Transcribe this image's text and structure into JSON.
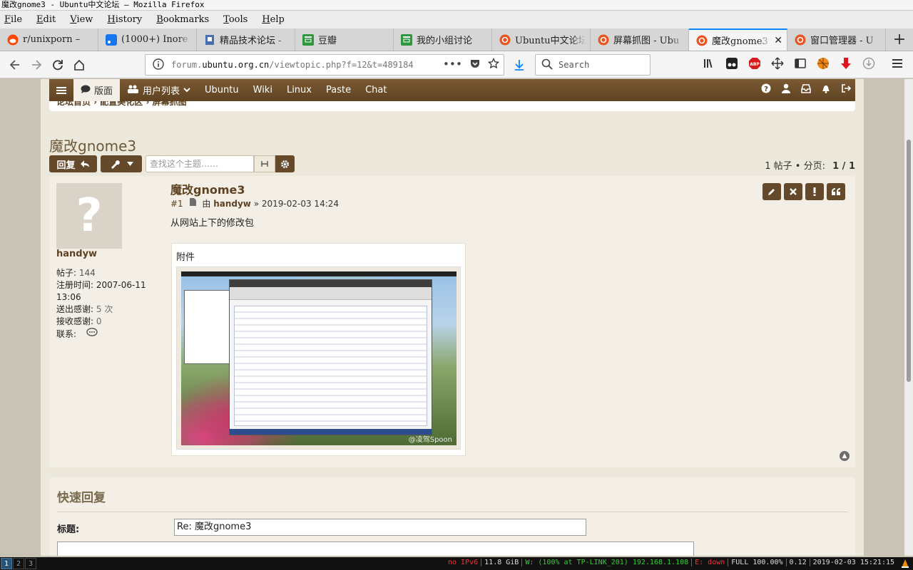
{
  "window": {
    "title": "魔改gnome3 - Ubuntu中文论坛 — Mozilla Firefox"
  },
  "menubar": [
    "File",
    "Edit",
    "View",
    "History",
    "Bookmarks",
    "Tools",
    "Help"
  ],
  "tabs": [
    {
      "label": "r/unixporn – ",
      "icon": "reddit-icon"
    },
    {
      "label": "(1000+) Inore",
      "icon": "rss-icon"
    },
    {
      "label": "精品技术论坛 -",
      "icon": "bookmark-icon"
    },
    {
      "label": "豆瓣",
      "icon": "douban-icon"
    },
    {
      "label": "我的小组讨论",
      "icon": "douban-icon"
    },
    {
      "label": "Ubuntu中文论坛",
      "icon": "ubuntu-icon"
    },
    {
      "label": "屏幕抓图 - Ubu",
      "icon": "ubuntu-icon"
    },
    {
      "label": "魔改gnome3",
      "icon": "ubuntu-icon",
      "active": true,
      "close": "✕"
    },
    {
      "label": "窗口管理器 - U",
      "icon": "ubuntu-icon"
    }
  ],
  "nav": {
    "url_prefix": "forum.",
    "url_domain": "ubuntu.org.cn",
    "url_suffix": "/viewtopic.php?f=12&t=489184",
    "search_placeholder": "Search"
  },
  "forum_nav": {
    "items": [
      "版面",
      "用户列表",
      "Ubuntu",
      "Wiki",
      "Linux",
      "Paste",
      "Chat"
    ],
    "active": "版面"
  },
  "breadcrumb": "论坛首页 › 配置美化区 › 屏幕抓图",
  "topic": {
    "title": "魔改gnome3",
    "reply_label": "回复",
    "search_placeholder": "查找这个主题……",
    "pagination_text": "1 帖子 • 分页:",
    "page_current": "1 / 1"
  },
  "post": {
    "title": "魔改gnome3",
    "number": "#1",
    "by_label": "由",
    "author": "handyw",
    "datetime": "» 2019-02-03 14:24",
    "body": "从网站上下的修改包",
    "attachment_label": "附件",
    "watermark": "@凌驾Spoon"
  },
  "profile": {
    "username": "handyw",
    "posts_label": "帖子:",
    "posts_value": "144",
    "registered_label": "注册时间:",
    "registered_value": "2007-06-11 13:06",
    "thanks_given_label": "送出感谢:",
    "thanks_given_value": "5 次",
    "thanks_received_label": "接收感谢:",
    "thanks_received_value": "0",
    "contact_label": "联系:"
  },
  "quick_reply": {
    "heading": "快速回复",
    "subject_label": "标题:",
    "subject_value": "Re: 魔改gnome3"
  },
  "statusbar": {
    "workspaces": [
      "1",
      "2",
      "3"
    ],
    "ipv6": "no IPv6",
    "disk": "11.8 GiB",
    "wifi": "W: (100% at TP-LINK_201) 192.168.1.108",
    "eth": "E: down",
    "battery": "FULL 100.00%",
    "load": "0.12",
    "datetime": "2019-02-03 15:21:15"
  },
  "colors": {
    "forum_brown": "#64492a",
    "accent_blue": "#0a84ff",
    "status_red": "#ff3030",
    "status_green": "#2fd12f"
  }
}
